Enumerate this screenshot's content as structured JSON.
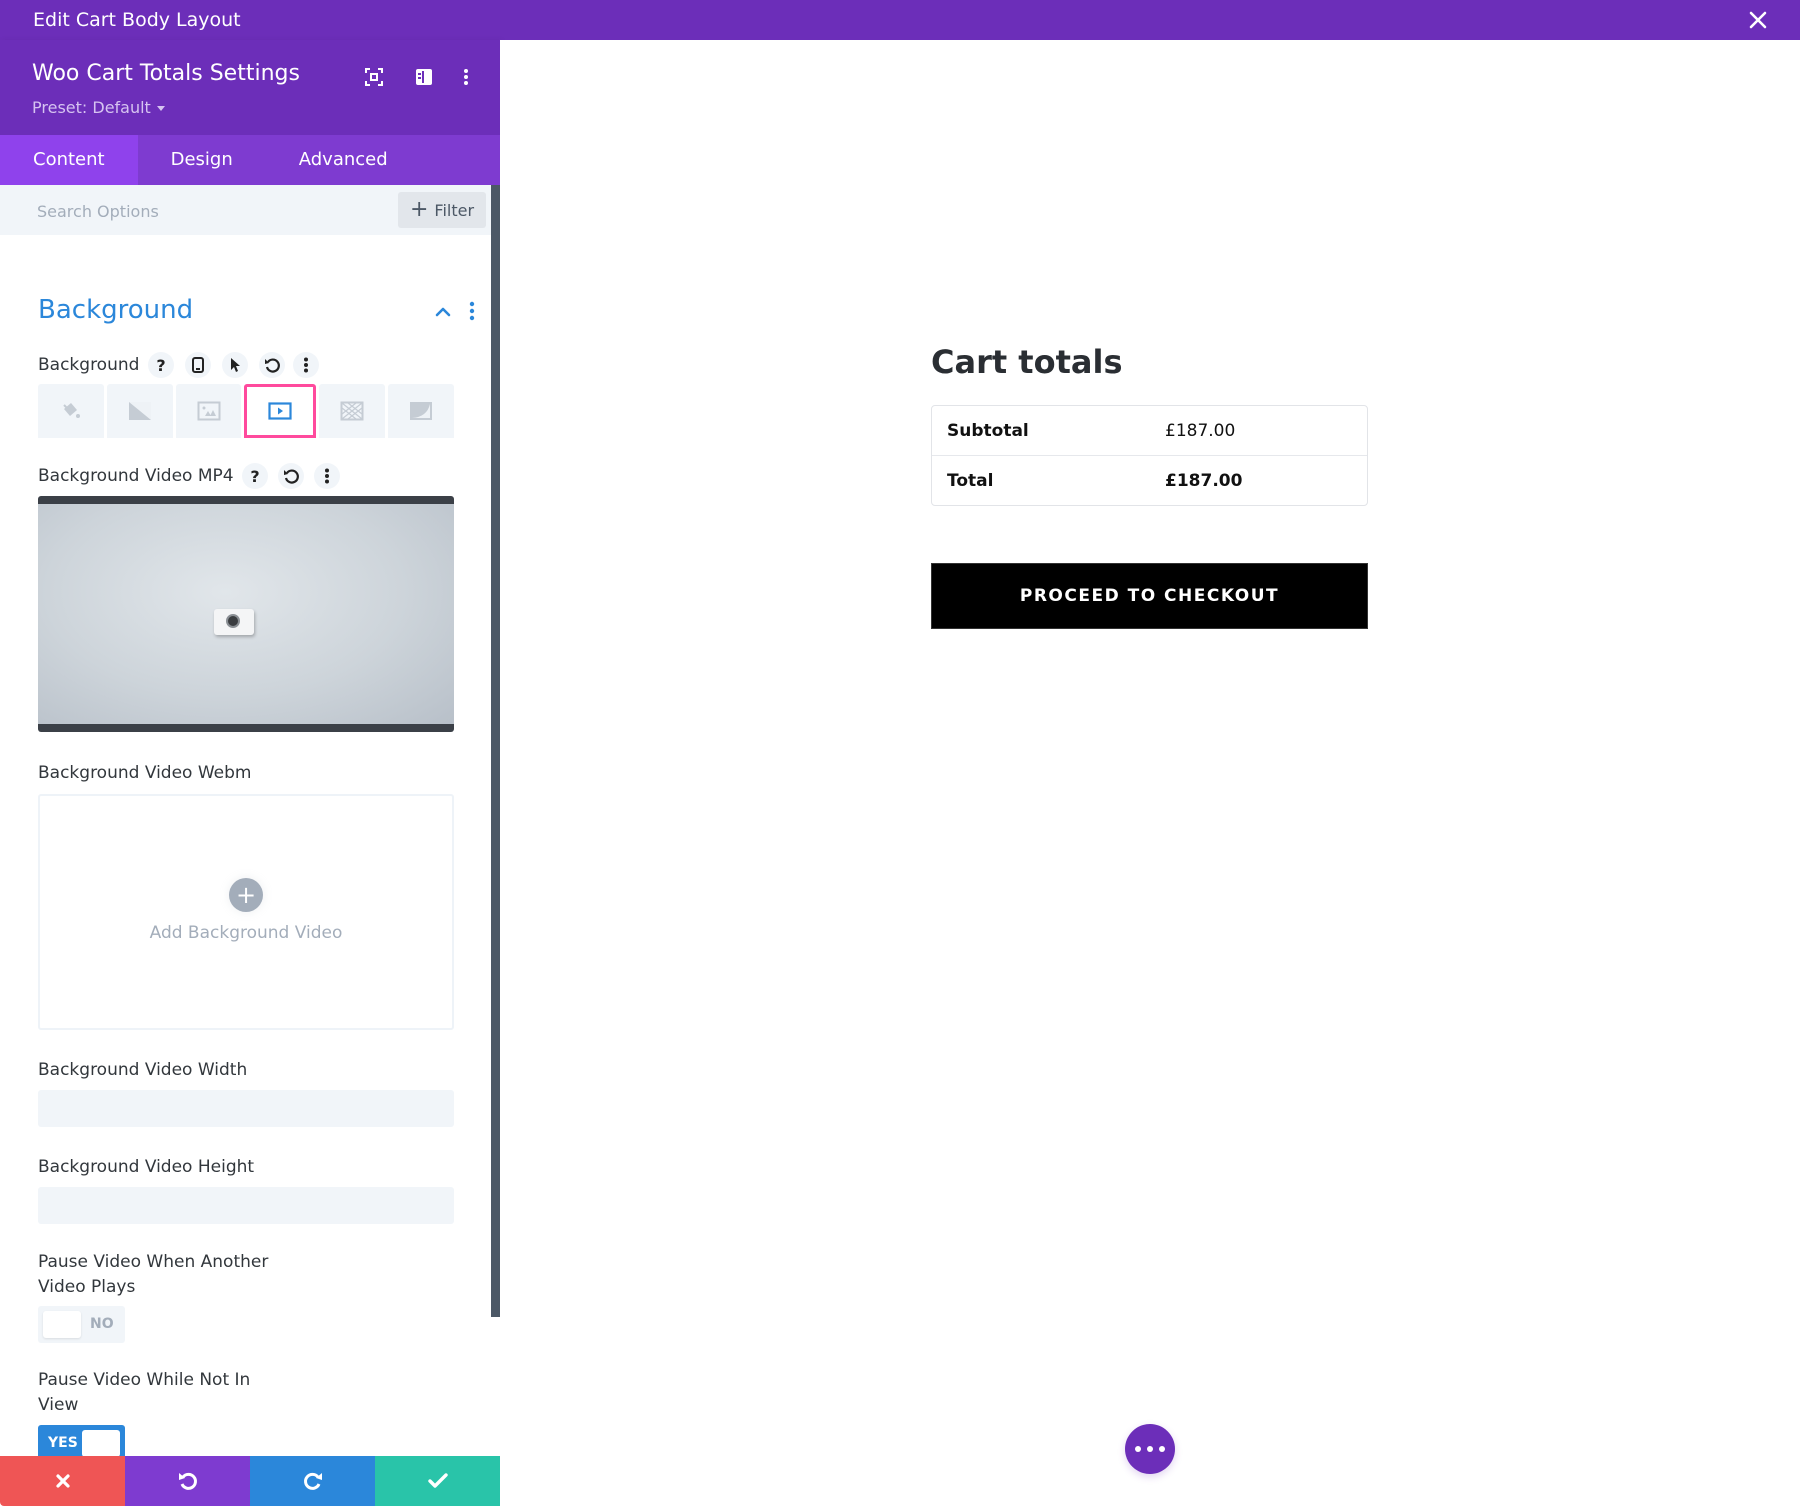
{
  "window": {
    "title": "Edit Cart Body Layout",
    "close_icon": "close-icon"
  },
  "panel": {
    "title": "Woo Cart Totals Settings",
    "preset_label": "Preset: Default",
    "header_icons": [
      "fullscreen-icon",
      "split-view-icon",
      "more-options-icon"
    ],
    "tabs": [
      {
        "label": "Content",
        "active": true
      },
      {
        "label": "Design",
        "active": false
      },
      {
        "label": "Advanced",
        "active": false
      }
    ],
    "search": {
      "placeholder": "Search Options",
      "value": ""
    },
    "filter_label": "Filter",
    "section": {
      "title": "Background",
      "expanded": true
    },
    "background_field": {
      "label": "Background",
      "icons": [
        "help-icon",
        "responsive-icon",
        "hover-icon",
        "reset-icon",
        "more-icon"
      ],
      "types": [
        {
          "name": "color",
          "icon": "paint-bucket-icon",
          "active": false
        },
        {
          "name": "gradient",
          "icon": "gradient-icon",
          "active": false
        },
        {
          "name": "image",
          "icon": "image-icon",
          "active": false
        },
        {
          "name": "video",
          "icon": "video-icon",
          "active": true
        },
        {
          "name": "pattern",
          "icon": "pattern-icon",
          "active": false
        },
        {
          "name": "mask",
          "icon": "mask-icon",
          "active": false
        }
      ]
    },
    "video_mp4": {
      "label": "Background Video MP4",
      "icons": [
        "help-icon",
        "reset-icon",
        "more-icon"
      ]
    },
    "video_webm": {
      "label": "Background Video Webm",
      "add_label": "Add Background Video"
    },
    "video_width": {
      "label": "Background Video Width",
      "value": ""
    },
    "video_height": {
      "label": "Background Video Height",
      "value": ""
    },
    "pause_other": {
      "label_line1": "Pause Video When Another",
      "label_line2": "Video Plays",
      "state": "NO"
    },
    "pause_not_in_view": {
      "label_line1": "Pause Video While Not In",
      "label_line2": "View",
      "state": "YES"
    },
    "bottom_actions": [
      "cancel",
      "undo",
      "redo",
      "save"
    ]
  },
  "cart": {
    "title": "Cart totals",
    "rows": [
      {
        "label": "Subtotal",
        "value": "£187.00"
      },
      {
        "label": "Total",
        "value": "£187.00"
      }
    ],
    "checkout_label": "PROCEED TO CHECKOUT"
  },
  "colors": {
    "brand_purple": "#6c2eb9",
    "tab_purple": "#7e3bd0",
    "accent_blue": "#2b87da",
    "highlight_pink": "#ff4a9d",
    "cancel_red": "#ef5555",
    "save_green": "#29c4a9"
  }
}
